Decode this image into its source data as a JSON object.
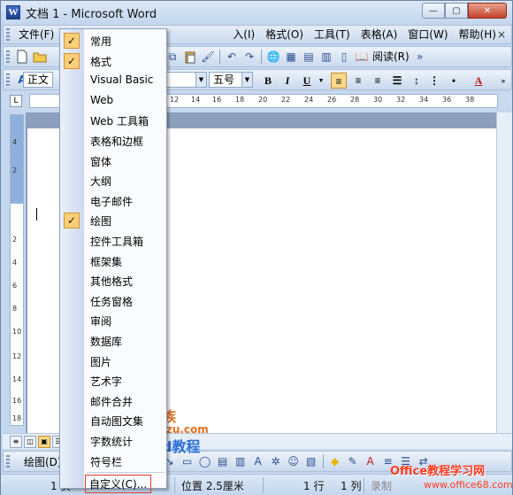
{
  "window": {
    "title": "文档 1 - Microsoft Word",
    "app_icon": "W"
  },
  "window_buttons": {
    "minimize": "—",
    "maximize": "▢",
    "close": "✕"
  },
  "menubar": {
    "items": [
      "文件(F)",
      "入(I)",
      "格式(O)",
      "工具(T)",
      "表格(A)",
      "窗口(W)",
      "帮助(H)"
    ],
    "close_doc": "×"
  },
  "toolbar_standard": {
    "read_label": "阅读(R)"
  },
  "toolbar_format": {
    "style_value": "正文",
    "size_value": "五号",
    "bold": "B",
    "italic": "I",
    "underline": "U",
    "font_color_icon": "A"
  },
  "ruler": {
    "corner": "L",
    "h_numbers": [
      "12",
      "14",
      "16",
      "18",
      "20",
      "22",
      "24",
      "26",
      "28",
      "30",
      "32",
      "34",
      "36",
      "38"
    ],
    "v_numbers": [
      "4",
      "2",
      "2",
      "4",
      "6",
      "8",
      "10",
      "12",
      "14",
      "16",
      "18"
    ]
  },
  "context_menu": {
    "items": [
      {
        "label": "常用",
        "checked": true
      },
      {
        "label": "格式",
        "checked": true
      },
      {
        "label": "Visual Basic",
        "checked": false
      },
      {
        "label": "Web",
        "checked": false
      },
      {
        "label": "Web 工具箱",
        "checked": false
      },
      {
        "label": "表格和边框",
        "checked": false
      },
      {
        "label": "窗体",
        "checked": false
      },
      {
        "label": "大纲",
        "checked": false
      },
      {
        "label": "电子邮件",
        "checked": false
      },
      {
        "label": "绘图",
        "checked": true
      },
      {
        "label": "控件工具箱",
        "checked": false
      },
      {
        "label": "框架集",
        "checked": false
      },
      {
        "label": "其他格式",
        "checked": false
      },
      {
        "label": "任务窗格",
        "checked": false
      },
      {
        "label": "审阅",
        "checked": false
      },
      {
        "label": "数据库",
        "checked": false
      },
      {
        "label": "图片",
        "checked": false
      },
      {
        "label": "艺术字",
        "checked": false
      },
      {
        "label": "邮件合并",
        "checked": false
      },
      {
        "label": "自动图文集",
        "checked": false
      },
      {
        "label": "字数统计",
        "checked": false
      },
      {
        "label": "符号栏",
        "checked": false
      }
    ],
    "customize": "自定义(C)...",
    "check_glyph": "✓"
  },
  "drawing_toolbar": {
    "label": "绘图(D)"
  },
  "statusbar": {
    "page": "1 页",
    "position": "位置 2.5厘米",
    "line": "1 行",
    "column": "1 列",
    "rec": "录制"
  },
  "watermarks": {
    "brand_cn": "办公族",
    "brand_url": "Officezu.com",
    "brand_word": "Word教程",
    "site_cn": "Office教程学习网",
    "site_url": "www.office68.com"
  },
  "colors": {
    "menu_check_bg": "#fbcf78",
    "title_bar": "#c3d6ee",
    "close_button": "#c4412c",
    "watermark_orange": "#e76f1e",
    "watermark_red": "#ff3b1f"
  }
}
